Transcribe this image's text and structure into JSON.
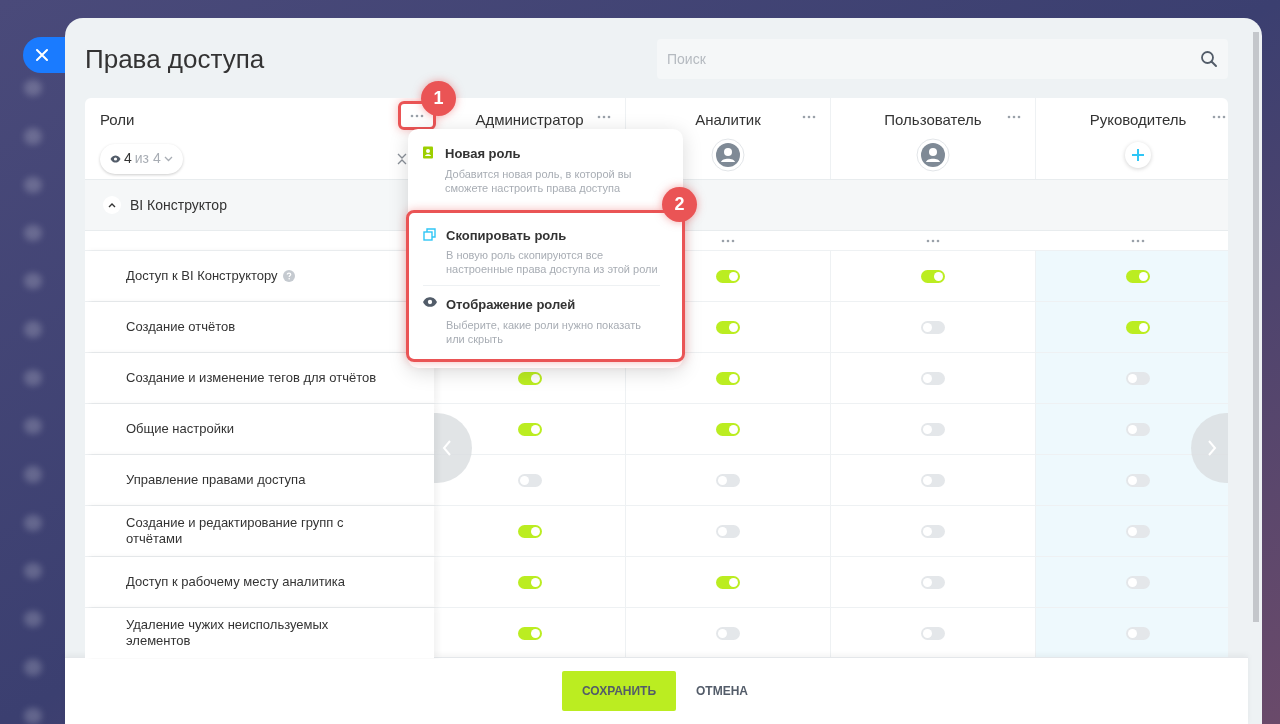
{
  "title": "Права доступа",
  "search": {
    "placeholder": "Поиск"
  },
  "roles_header": {
    "label": "Роли",
    "filter": {
      "count": "4",
      "of": "из 4"
    }
  },
  "columns": [
    {
      "name": "Администратор"
    },
    {
      "name": "Аналитик",
      "kind": "avatar"
    },
    {
      "name": "Пользователь",
      "kind": "avatar"
    },
    {
      "name": "Руководитель",
      "kind": "add"
    }
  ],
  "group": {
    "label": "BI Конструктор",
    "expanded": true
  },
  "rows": [
    {
      "label": "Доступ к BI Конструктору",
      "help": true,
      "toggles": [
        true,
        true,
        true
      ]
    },
    {
      "label": "Создание отчётов",
      "help": false,
      "toggles": [
        true,
        false,
        true
      ]
    },
    {
      "label": "Создание и изменение тегов для отчётов",
      "help": false,
      "toggles": [
        true,
        true,
        false,
        false
      ]
    },
    {
      "label": "Общие настройки",
      "help": false,
      "toggles": [
        true,
        true,
        false,
        false
      ]
    },
    {
      "label": "Управление правами доступа",
      "help": false,
      "toggles": [
        false,
        false,
        false,
        false
      ]
    },
    {
      "label": "Создание и редактирование групп с отчётами",
      "help": false,
      "toggles": [
        true,
        false,
        false,
        false
      ]
    },
    {
      "label": "Доступ к рабочему месту аналитика",
      "help": false,
      "toggles": [
        true,
        true,
        false,
        false
      ]
    },
    {
      "label": "Удаление чужих неиспользуемых элементов",
      "help": false,
      "toggles": [
        true,
        false,
        false,
        false
      ]
    }
  ],
  "menu": [
    {
      "kind": "new",
      "title": "Новая роль",
      "description": "Добавится новая роль, в которой вы сможете настроить права доступа"
    },
    {
      "kind": "copy",
      "title": "Скопировать роль",
      "description": "В новую роль скопируются все настроенные права доступа из этой роли"
    },
    {
      "kind": "view",
      "title": "Отображение ролей",
      "description": "Выберите, какие роли нужно показать или скрыть"
    }
  ],
  "annotations": [
    "1",
    "2"
  ],
  "footer": {
    "save": "СОХРАНИТЬ",
    "cancel": "ОТМЕНА"
  }
}
